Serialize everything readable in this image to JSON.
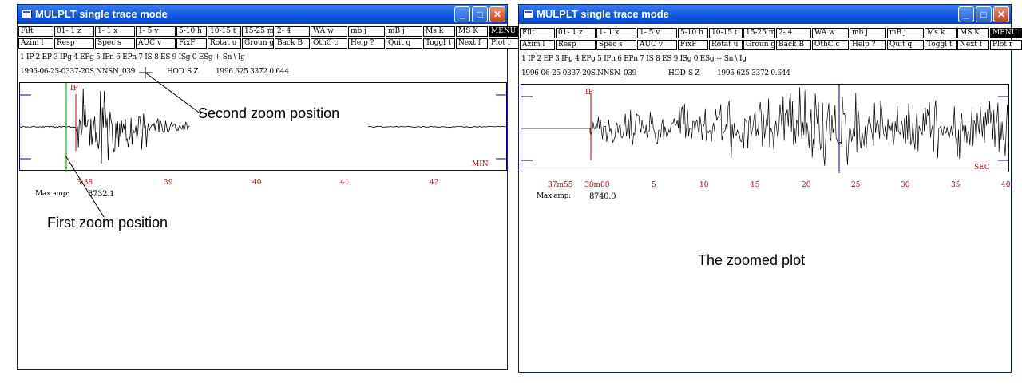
{
  "left_window": {
    "title": "MULPLT single trace mode",
    "menu_row1": [
      "Filt",
      "01- 1 z",
      "1- 1 x",
      "1- 5 v",
      "5-10 h",
      "10-15 t",
      "15-25 m",
      "2- 4",
      "WA w",
      "mb j",
      "mB j",
      "Ms k",
      "MS K",
      "MENU"
    ],
    "menu_row2": [
      "Azim l",
      "Resp",
      "Spec s",
      "AUC v",
      "FixF",
      "Rotat u",
      "Groun g",
      "Back B",
      "OthC c",
      "Help ?",
      "Quit q",
      "Toggl t",
      "Next f",
      "Plot r"
    ],
    "phase_line": "1 IP  2 EP  3 IPg 4 EPg 5 IPn 6 EPn 7 IS  8 ES  9 ISg 0 ESg + Sn \\ Ig",
    "trace_id": "1996-06-25-0337-20S.NNSN_039",
    "station": "HOD",
    "component": "S  Z",
    "start_time": "1996 625 3372 0.644",
    "phase_marker": "IP",
    "unit": "MIN",
    "x_ticks": [
      "38",
      "39",
      "40",
      "41",
      "42"
    ],
    "cursor_time": "3:38",
    "max_amp_label": "Max amp:",
    "max_amp_value": "8732.1"
  },
  "right_window": {
    "title": "MULPLT single trace mode",
    "menu_row1": [
      "Filt",
      "01- 1 z",
      "1- 1 x",
      "1- 5 v",
      "5-10 h",
      "10-15 t",
      "15-25 m",
      "2- 4",
      "WA w",
      "mb j",
      "mB j",
      "Ms k",
      "MS K",
      "MENU"
    ],
    "menu_row2": [
      "Azim l",
      "Resp",
      "Spec s",
      "AUC v",
      "FixF",
      "Rotat u",
      "Groun g",
      "Back B",
      "OthC c",
      "Help ?",
      "Quit q",
      "Toggl t",
      "Next f",
      "Plot r"
    ],
    "phase_line": "1 IP  2 EP  3 IPg 4 EPg 5 IPn 6 EPn 7 IS  8 ES  9 ISg 0 ESg + Sn \\ Ig",
    "trace_id": "1996-06-25-0337-20S.NNSN_039",
    "station": "HOD",
    "component": "S  Z",
    "start_time": "1996 625 3372 0.644",
    "phase_marker": "IP",
    "unit": "SEC",
    "x_ticks": [
      "37m55",
      "38m00",
      "5",
      "10",
      "15",
      "20",
      "25",
      "30",
      "35",
      "40"
    ],
    "max_amp_label": "Max amp:",
    "max_amp_value": "8740.0"
  },
  "annotations": {
    "second_zoom": "Second zoom position",
    "first_zoom": "First zoom position",
    "zoomed_plot": "The zoomed plot"
  },
  "colors": {
    "titlebar": "#0a56e0",
    "plot_frame": "#00008b",
    "axis_label": "#c00000",
    "zoom_marker_1": "#00c000",
    "zoom_marker_2": "#000000"
  }
}
